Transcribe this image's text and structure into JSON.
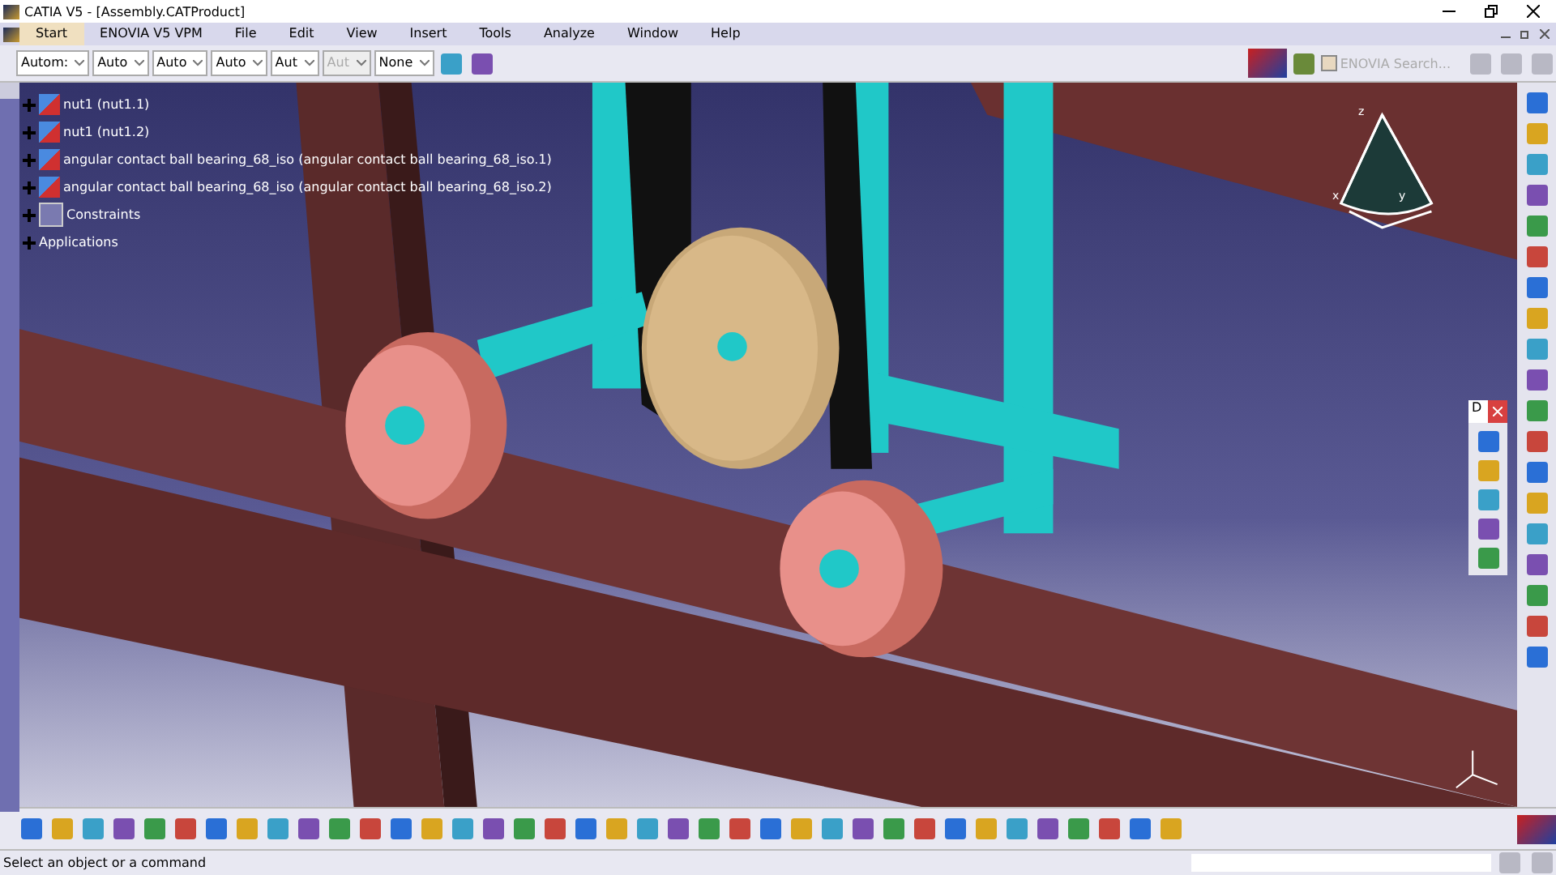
{
  "window": {
    "title": "CATIA V5 - [Assembly.CATProduct]"
  },
  "menu": [
    {
      "label": "Start",
      "selected": true
    },
    {
      "label": "ENOVIA V5 VPM",
      "selected": false
    },
    {
      "label": "File",
      "selected": false
    },
    {
      "label": "Edit",
      "selected": false
    },
    {
      "label": "View",
      "selected": false
    },
    {
      "label": "Insert",
      "selected": false
    },
    {
      "label": "Tools",
      "selected": false
    },
    {
      "label": "Analyze",
      "selected": false
    },
    {
      "label": "Window",
      "selected": false
    },
    {
      "label": "Help",
      "selected": false
    }
  ],
  "toolbar_dropdowns": [
    {
      "value": "Autom:",
      "disabled": false
    },
    {
      "value": "Auto",
      "disabled": false
    },
    {
      "value": "Auto",
      "disabled": false
    },
    {
      "value": "Auto",
      "disabled": false
    },
    {
      "value": "Aut",
      "disabled": false
    },
    {
      "value": "Aut",
      "disabled": true
    },
    {
      "value": "None",
      "disabled": false
    }
  ],
  "enovia_search": {
    "label": "ENOVIA Search...",
    "checked": false
  },
  "tree": [
    {
      "label": "nut1 (nut1.1)",
      "kind": "part"
    },
    {
      "label": "nut1 (nut1.2)",
      "kind": "part"
    },
    {
      "label": "angular contact ball bearing_68_iso (angular contact ball bearing_68_iso.1)",
      "kind": "part"
    },
    {
      "label": "angular contact ball bearing_68_iso (angular contact ball bearing_68_iso.2)",
      "kind": "part"
    },
    {
      "label": "Constraints",
      "kind": "constraints"
    },
    {
      "label": "Applications",
      "kind": "applications"
    }
  ],
  "floating_toolbar": {
    "title": "D"
  },
  "axis_labels": [
    "z",
    "x",
    "y"
  ],
  "status_bar": {
    "message": "Select an object or a command"
  }
}
